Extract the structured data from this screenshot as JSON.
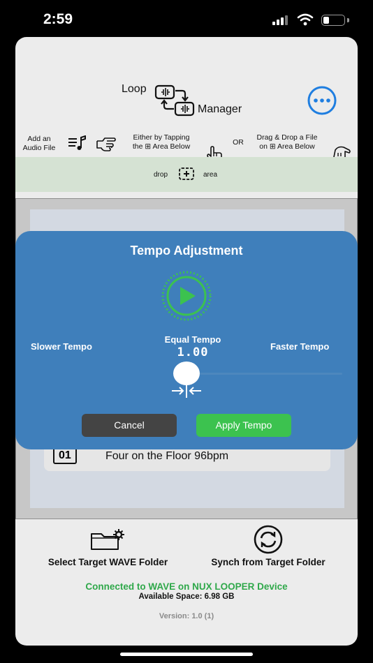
{
  "status_bar": {
    "time": "2:59"
  },
  "header": {
    "logo_word1": "Loop",
    "logo_word2": "Manager",
    "more_icon": "ellipsis-circle-icon"
  },
  "hints": {
    "add_audio": "Add an\nAudio File",
    "tap_hint": "Either by Tapping\nthe ⊞ Area Below",
    "or_label": "OR",
    "drag_hint": "Drag & Drop a File\non ⊞ Area Below"
  },
  "drop_area": {
    "left": "drop",
    "right": "area"
  },
  "tracks": [
    {
      "number": "01",
      "title": "Four on the Floor 96bpm"
    }
  ],
  "modal": {
    "title": "Tempo Adjustment",
    "slower": "Slower Tempo",
    "equal": "Equal Tempo",
    "faster": "Faster Tempo",
    "value": "1.00",
    "cancel": "Cancel",
    "apply": "Apply Tempo",
    "accent_color": "#3cc24f",
    "panel_color": "#3f7fbb"
  },
  "bottom": {
    "select_folder": "Select Target WAVE Folder",
    "synch": "Synch from Target Folder",
    "connected": "Connected to WAVE on NUX LOOPER Device",
    "space": "Available Space: 6.98 GB",
    "version": "Version: 1.0 (1)"
  }
}
